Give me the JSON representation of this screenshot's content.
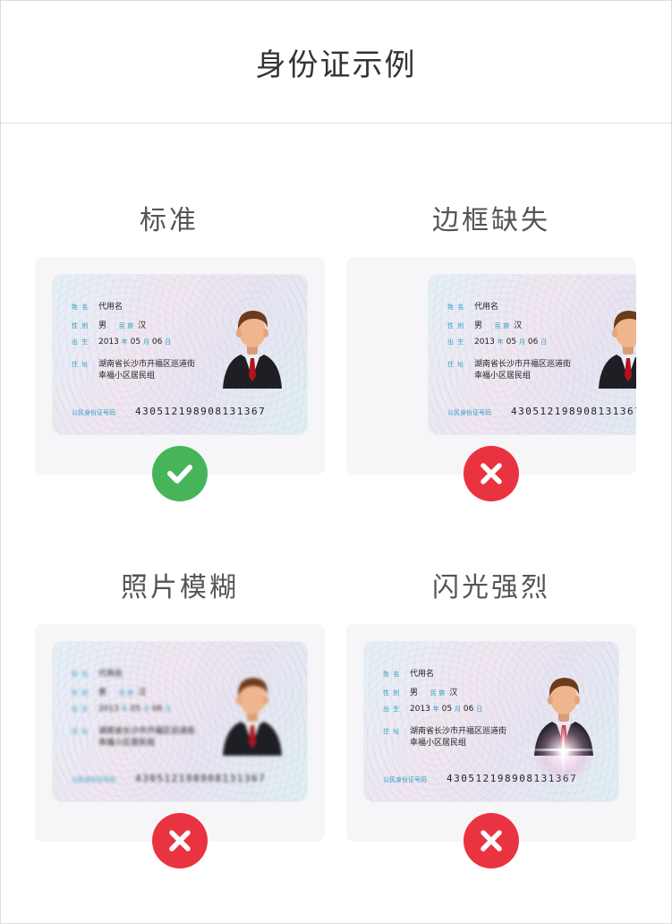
{
  "header": {
    "title": "身份证示例"
  },
  "examples": [
    {
      "title": "标准",
      "status": "ok"
    },
    {
      "title": "边框缺失",
      "status": "bad"
    },
    {
      "title": "照片模糊",
      "status": "bad"
    },
    {
      "title": "闪光强烈",
      "status": "bad"
    }
  ],
  "card": {
    "name_label": "姓 名",
    "name": "代用名",
    "gender_label": "性 别",
    "gender": "男",
    "ethnic_label": "民 族",
    "ethnic": "汉",
    "birth_label": "出 生",
    "birth_year": "2013",
    "year_unit": "年",
    "birth_month": "05",
    "month_unit": "月",
    "birth_day": "06",
    "day_unit": "日",
    "address_label": "住 址",
    "address_line1": "湖南省长沙市开福区巡道街",
    "address_line2": "幸福小区居民组",
    "id_label": "公民身份证号码",
    "id_number": "430512198908131367"
  },
  "colors": {
    "ok": "#46b55a",
    "bad": "#ea3340",
    "label": "#2b9cc6",
    "panel": "#f6f6f8"
  },
  "icons": {
    "ok": "check-icon",
    "bad": "cross-icon"
  }
}
